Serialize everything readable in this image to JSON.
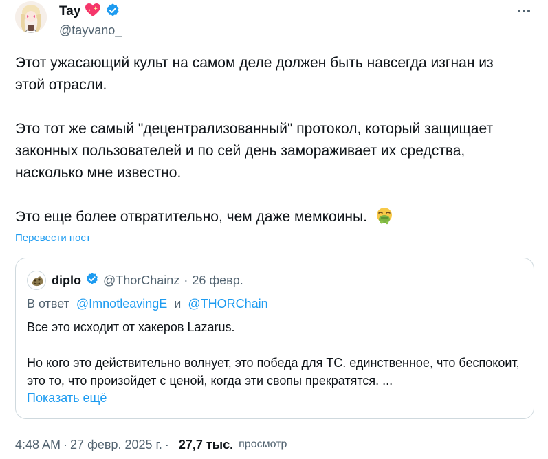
{
  "author": {
    "display_name": "Tay",
    "handle": "@tayvano_",
    "verified": true,
    "name_emoji": "heart-with-sparkles",
    "badge_color": "#1d9bf0"
  },
  "more_icon": "more-horizontal-icon",
  "body": {
    "paragraphs": [
      "Этот ужасающий культ на самом деле должен быть навсегда изгнан из этой отрасли.",
      "Это тот же самый \"децентрализованный\" протокол, который защищает законных пользователей и по сей день замораживает их средства, насколько мне известно.",
      "Это еще более отвратительно, чем даже мемкоины."
    ],
    "trailing_emoji": "face-vomiting"
  },
  "translate_label": "Перевести пост",
  "quote": {
    "display_name": "diplo",
    "handle": "@ThorChainz",
    "dot": "·",
    "date": "26 февр.",
    "verified": true,
    "reply_prefix": "В ответ",
    "reply_mention_1": "@ImnotleavingE",
    "reply_and": "и",
    "reply_mention_2": "@THORChain",
    "paragraphs": [
      "Все это исходит от хакеров Lazarus.",
      "Но кого это действительно волнует, это победа для TC. единственное, что беспокоит, это то, что произойдет с ценой, когда эти свопы прекратятся. ..."
    ],
    "show_more": "Показать ещё"
  },
  "meta": {
    "time": "4:48 AM",
    "sep1": "·",
    "date": "27 февр. 2025 г.",
    "sep2": "·",
    "views_count": "27,7 тыс.",
    "views_label": "просмотр"
  },
  "colors": {
    "link": "#1d9bf0",
    "secondary_text": "#536471",
    "primary_text": "#0f1419",
    "border": "#cfd9de"
  }
}
